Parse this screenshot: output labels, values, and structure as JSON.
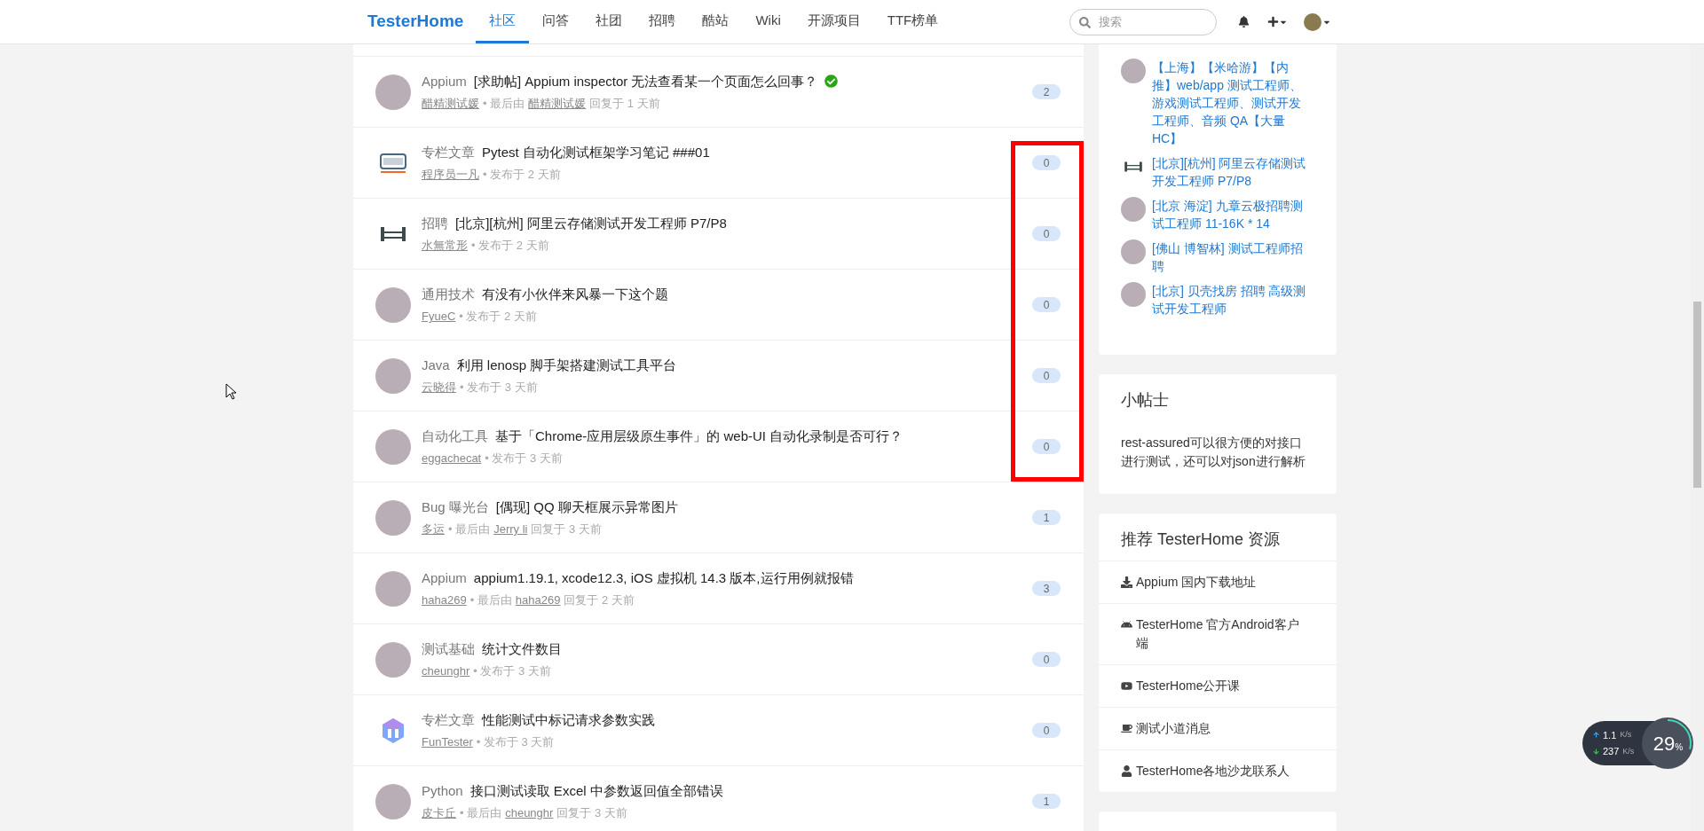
{
  "navbar": {
    "brand": "TesterHome",
    "tabs": [
      {
        "label": "社区",
        "selected": true
      },
      {
        "label": "问答",
        "selected": false
      },
      {
        "label": "社团",
        "selected": false
      },
      {
        "label": "招聘",
        "selected": false
      },
      {
        "label": "酷站",
        "selected": false
      },
      {
        "label": "Wiki",
        "selected": false
      },
      {
        "label": "开源项目",
        "selected": false
      },
      {
        "label": "TTF榜单",
        "selected": false
      }
    ],
    "search": {
      "placeholder": "搜索"
    }
  },
  "topics": [
    {
      "avatar": {
        "kind": "photo"
      },
      "category": "Appium",
      "title": "[求助帖] Appium inspector 无法查看某一个页面怎么回事？",
      "solved": true,
      "meta": [
        {
          "kind": "user",
          "text": "醋精测试媛"
        },
        {
          "kind": "plain",
          "text": "• 最后由"
        },
        {
          "kind": "user",
          "text": "醋精测试媛"
        },
        {
          "kind": "plain",
          "text": "回复于 1 天前"
        }
      ],
      "replies": "2"
    },
    {
      "avatar": {
        "kind": "tester-logo"
      },
      "category": "专栏文章",
      "title": "Pytest 自动化测试框架学习笔记 ###01",
      "solved": false,
      "meta": [
        {
          "kind": "user",
          "text": "程序员一凡"
        },
        {
          "kind": "plain",
          "text": "• 发布于 2 天前"
        }
      ],
      "replies": "0"
    },
    {
      "avatar": {
        "kind": "beam"
      },
      "category": "招聘",
      "title": "[北京][杭州] 阿里云存储测试开发工程师 P7/P8",
      "solved": false,
      "meta": [
        {
          "kind": "user",
          "text": "水無常形"
        },
        {
          "kind": "plain",
          "text": "• 发布于 2 天前"
        }
      ],
      "replies": "0"
    },
    {
      "avatar": {
        "kind": "photo"
      },
      "category": "通用技术",
      "title": "有没有小伙伴来风暴一下这个题",
      "solved": false,
      "meta": [
        {
          "kind": "user",
          "text": "FyueC"
        },
        {
          "kind": "plain",
          "text": "• 发布于 2 天前"
        }
      ],
      "replies": "0"
    },
    {
      "avatar": {
        "kind": "photo"
      },
      "category": "Java",
      "title": "利用 lenosp 脚手架搭建测试工具平台",
      "solved": false,
      "meta": [
        {
          "kind": "user",
          "text": "云晓得"
        },
        {
          "kind": "plain",
          "text": "• 发布于 3 天前"
        }
      ],
      "replies": "0"
    },
    {
      "avatar": {
        "kind": "photo"
      },
      "category": "自动化工具",
      "title": "基于「Chrome-应用层级原生事件」的 web-UI 自动化录制是否可行？",
      "solved": false,
      "meta": [
        {
          "kind": "user",
          "text": "eggachecat"
        },
        {
          "kind": "plain",
          "text": "• 发布于 3 天前"
        }
      ],
      "replies": "0"
    },
    {
      "avatar": {
        "kind": "photo"
      },
      "category": "Bug 曝光台",
      "title": "[偶现] QQ 聊天框展示异常图片",
      "solved": false,
      "meta": [
        {
          "kind": "user",
          "text": "多运"
        },
        {
          "kind": "plain",
          "text": "• 最后由"
        },
        {
          "kind": "user",
          "text": "Jerry li"
        },
        {
          "kind": "plain",
          "text": "回复于 3 天前"
        }
      ],
      "replies": "1"
    },
    {
      "avatar": {
        "kind": "photo"
      },
      "category": "Appium",
      "title": "appium1.19.1, xcode12.3, iOS 虚拟机 14.3 版本,运行用例就报错",
      "solved": false,
      "meta": [
        {
          "kind": "user",
          "text": "haha269"
        },
        {
          "kind": "plain",
          "text": "• 最后由"
        },
        {
          "kind": "user",
          "text": "haha269"
        },
        {
          "kind": "plain",
          "text": "回复于 2 天前"
        }
      ],
      "replies": "3"
    },
    {
      "avatar": {
        "kind": "photo"
      },
      "category": "测试基础",
      "title": "统计文件数目",
      "solved": false,
      "meta": [
        {
          "kind": "user",
          "text": "cheunghr"
        },
        {
          "kind": "plain",
          "text": "• 发布于 3 天前"
        }
      ],
      "replies": "0"
    },
    {
      "avatar": {
        "kind": "cube-logo"
      },
      "category": "专栏文章",
      "title": "性能测试中标记请求参数实践",
      "solved": false,
      "meta": [
        {
          "kind": "user",
          "text": "FunTester"
        },
        {
          "kind": "plain",
          "text": "• 发布于 3 天前"
        }
      ],
      "replies": "0"
    },
    {
      "avatar": {
        "kind": "photo"
      },
      "category": "Python",
      "title": "接口测试读取 Excel 中参数返回值全部错误",
      "solved": false,
      "meta": [
        {
          "kind": "user",
          "text": "皮卡丘"
        },
        {
          "kind": "plain",
          "text": "• 最后由"
        },
        {
          "kind": "user",
          "text": "cheunghr"
        },
        {
          "kind": "plain",
          "text": "回复于 3 天前"
        }
      ],
      "replies": "1"
    }
  ],
  "jobs": [
    {
      "avatar": {
        "kind": "photo"
      },
      "text": "【上海】【米哈游】【内推】web/app 测试工程师、游戏测试工程师、测试开发工程师、音频 QA【大量 HC】"
    },
    {
      "avatar": {
        "kind": "beam"
      },
      "text": "[北京][杭州] 阿里云存储测试开发工程师 P7/P8"
    },
    {
      "avatar": {
        "kind": "photo"
      },
      "text": "[北京 海淀] 九章云极招聘测试工程师 11-16K * 14"
    },
    {
      "avatar": {
        "kind": "photo"
      },
      "text": "[佛山 博智林] 测试工程师招聘"
    },
    {
      "avatar": {
        "kind": "photo"
      },
      "text": "[北京] 贝壳找房 招聘 高级测试开发工程师"
    }
  ],
  "tips": {
    "title": "小帖士",
    "body": "rest-assured可以很方便的对接口进行测试，还可以对json进行解析"
  },
  "resources": {
    "title": "推荐 TesterHome 资源",
    "items": [
      {
        "kind": "download",
        "label": "Appium 国内下载地址"
      },
      {
        "kind": "android",
        "label": "TesterHome 官方Android客户端"
      },
      {
        "kind": "video",
        "label": "TesterHome公开课"
      },
      {
        "kind": "coffee",
        "label": "测试小道消息"
      },
      {
        "kind": "person",
        "label": "TesterHome各地沙龙联系人"
      }
    ]
  },
  "net_monitor": {
    "upload": "1.1",
    "upload_unit": "K/s",
    "download": "237",
    "download_unit": "K/s",
    "cpu": "29",
    "cpu_unit": "%",
    "level": 0.29
  }
}
